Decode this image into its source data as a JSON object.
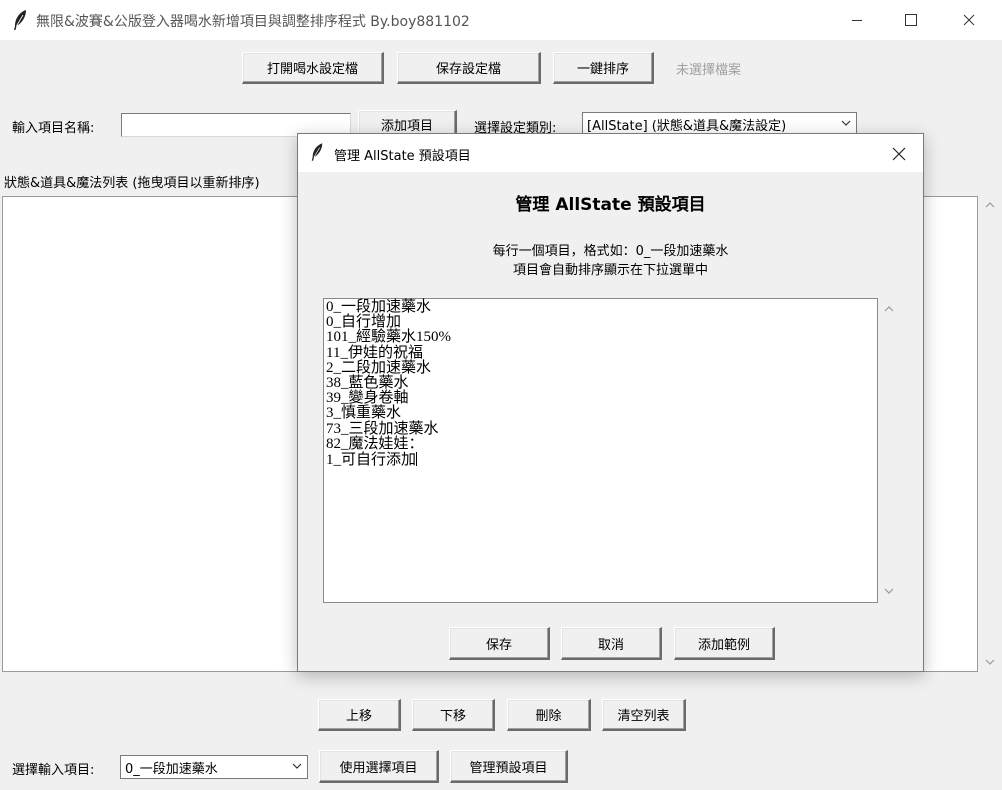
{
  "window": {
    "title": "無限&波賽&公版登入器喝水新增項目與調整排序程式 By.boy881102",
    "icon": "feather-icon"
  },
  "toolbar": {
    "open_label": "打開喝水設定檔",
    "save_label": "保存設定檔",
    "sort_label": "一鍵排序",
    "file_status": "未選擇檔案"
  },
  "input_row": {
    "name_label": "輸入項目名稱:",
    "name_value": "",
    "add_label": "添加項目",
    "category_label": "選擇設定類別:",
    "category_value": "[AllState] (狀態&道具&魔法設定)"
  },
  "list": {
    "label": "狀態&道具&魔法列表 (拖曳項目以重新排序)"
  },
  "bottom_buttons": {
    "up": "上移",
    "down": "下移",
    "delete": "刪除",
    "clear": "清空列表"
  },
  "select_row": {
    "label": "選擇輸入項目:",
    "value": "0_一段加速藥水",
    "use_label": "使用選擇項目",
    "manage_label": "管理預設項目"
  },
  "dialog": {
    "title": "管理 AllState 預設項目",
    "heading": "管理 AllState 預設項目",
    "desc1": "每行一個項目，格式如：0_一段加速藥水",
    "desc2": "項目會自動排序顯示在下拉選單中",
    "items": [
      "0_一段加速藥水",
      "0_自行增加",
      "101_經驗藥水150%",
      "11_伊娃的祝福",
      "2_二段加速藥水",
      "38_藍色藥水",
      "39_變身卷軸",
      "3_慎重藥水",
      "73_三段加速藥水",
      "82_魔法娃娃：",
      "1_可自行添加"
    ],
    "save_label": "保存",
    "cancel_label": "取消",
    "example_label": "添加範例"
  },
  "colors": {
    "window_bg": "#f0f0f0",
    "titlebar_bg": "#ffffff",
    "disabled_text": "#a0a0a0"
  }
}
